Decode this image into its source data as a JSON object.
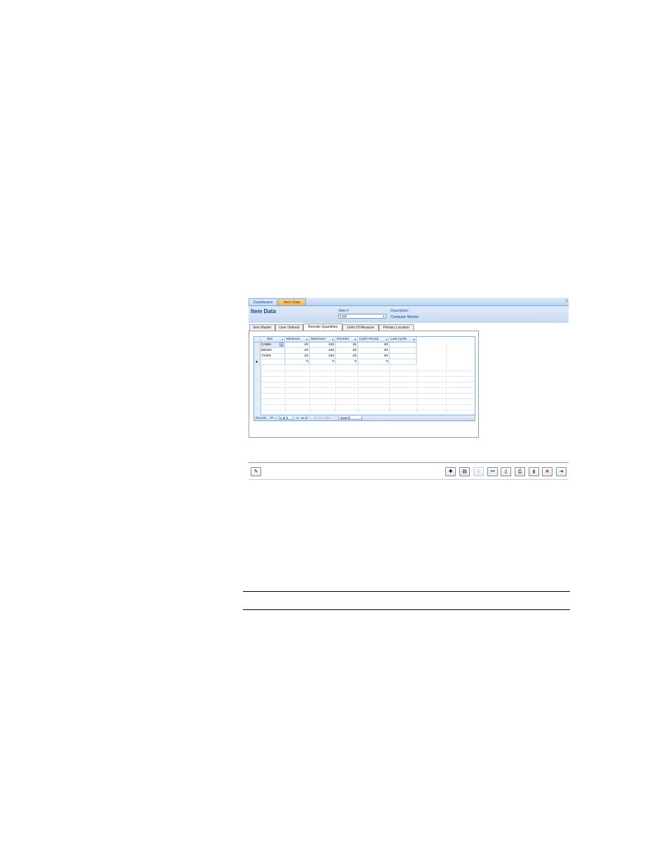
{
  "doc_tabs": {
    "dashboard": "Dashboard",
    "item_data": "Item Data",
    "close": "x"
  },
  "header": {
    "title": "Item Data",
    "item_label": "Item #",
    "item_value": "C110",
    "description_label": "Description",
    "description_value": "Computer Monitor"
  },
  "page_tabs": [
    "Item Master",
    "User Defined",
    "Reorder Quantities",
    "Units Of Measure",
    "Primary Location"
  ],
  "grid": {
    "columns": [
      "Site",
      "Minimum",
      "Maximum",
      "Reorder",
      "Cycle Period",
      "Last Cycle"
    ],
    "rows": [
      [
        "CAWH",
        "20",
        "100",
        "25",
        "90",
        ""
      ],
      [
        "MDWH",
        "20",
        "100",
        "25",
        "90",
        ""
      ],
      [
        "TXWH",
        "20",
        "100",
        "25",
        "90",
        ""
      ],
      [
        "",
        "0",
        "0",
        "0",
        "0",
        ""
      ]
    ]
  },
  "navigator": {
    "label": "Record:",
    "position": "1 of 3",
    "filter": "No Filter",
    "search": "Search"
  },
  "toolbar": {
    "left_icon": "edit-note-icon",
    "right_icons": [
      "new-record-icon",
      "save-record-icon",
      "find-icon",
      "find-next-icon",
      "print-preview-icon",
      "print-icon",
      "delete-record-icon",
      "close-form-icon",
      "exit-icon"
    ]
  }
}
